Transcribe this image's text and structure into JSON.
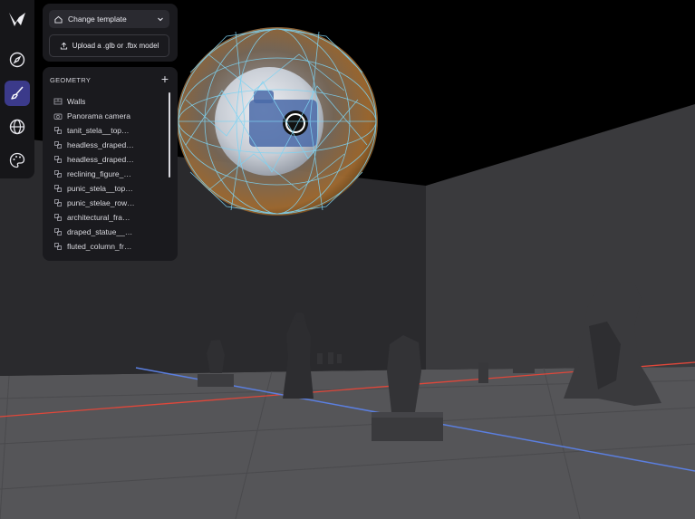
{
  "toolbar": {
    "change_template_label": "Change template",
    "upload_label": "Upload a .glb or .fbx model"
  },
  "rail": {
    "icons": [
      "logo-icon",
      "compass-icon",
      "brush-icon",
      "globe-icon",
      "palette-icon"
    ],
    "active": "brush-icon"
  },
  "geometry": {
    "heading": "GEOMETRY",
    "add_label": "+",
    "items": [
      {
        "label": "Walls",
        "icon": "walls-icon"
      },
      {
        "label": "Panorama camera",
        "icon": "camera-icon"
      },
      {
        "label": "tanit_stela__top…",
        "icon": "model-icon"
      },
      {
        "label": "headless_draped…",
        "icon": "model-icon"
      },
      {
        "label": "headless_draped…",
        "icon": "model-icon"
      },
      {
        "label": "reclining_figure_…",
        "icon": "model-icon"
      },
      {
        "label": "punic_stela__top…",
        "icon": "model-icon"
      },
      {
        "label": "punic_stelae_row…",
        "icon": "model-icon"
      },
      {
        "label": "architectural_fra…",
        "icon": "model-icon"
      },
      {
        "label": "draped_statue__…",
        "icon": "model-icon"
      },
      {
        "label": "fluted_column_fr…",
        "icon": "model-icon"
      }
    ]
  },
  "colors": {
    "accent": "#3b3a8a",
    "axis_x": "#e0473a",
    "axis_z": "#5b7fe0",
    "wireframe": "#7ed3f2"
  }
}
